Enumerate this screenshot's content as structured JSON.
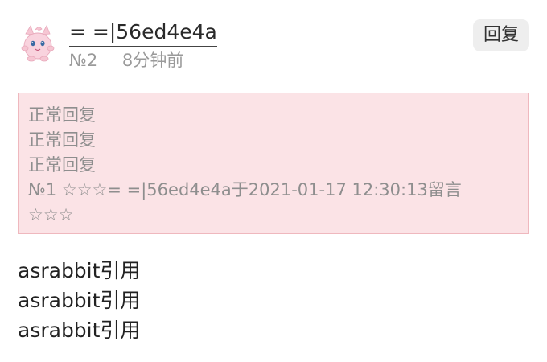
{
  "comment": {
    "username": "= =|56ed4e4a",
    "floor": "№2",
    "time_ago": "8分钟前",
    "reply_label": "回复",
    "avatar_icon": "pink-puffball-avatar-icon"
  },
  "quote": {
    "lines": [
      "正常回复",
      "正常回复",
      "正常回复",
      "№1 ☆☆☆= =|56ed4e4a于2021-01-17 12:30:13留言",
      "☆☆☆"
    ],
    "background_color": "#fbe3e6",
    "border_color": "#efb8be"
  },
  "body": {
    "lines": [
      "asrabbit引用",
      "asrabbit引用",
      "asrabbit引用"
    ]
  }
}
